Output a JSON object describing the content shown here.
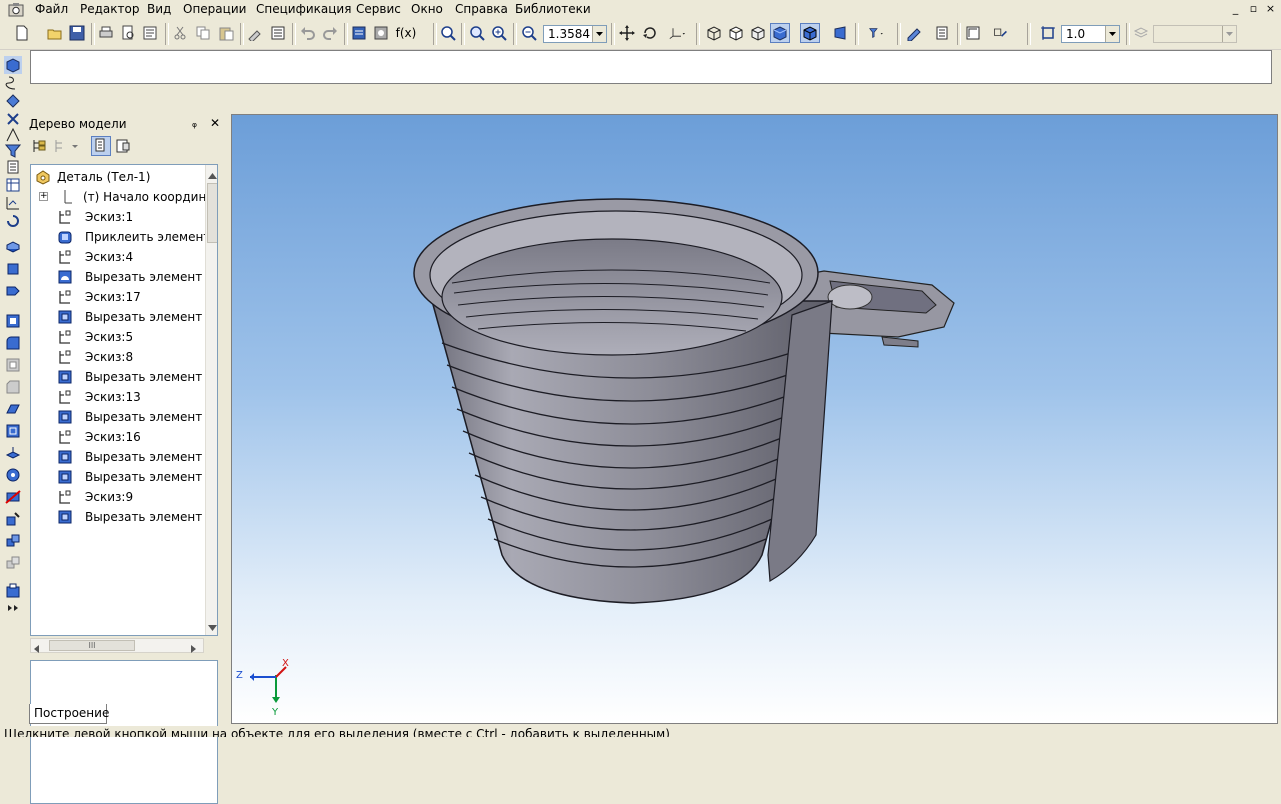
{
  "menu": {
    "items": [
      "Файл",
      "Редактор",
      "Вид",
      "Операции",
      "Спецификация",
      "Сервис",
      "Окно",
      "Справка",
      "Библиотеки"
    ],
    "window_controls": [
      "_",
      "▫",
      "×"
    ]
  },
  "toolbar": {
    "zoom_value": "1.3584",
    "step_value": "1.0",
    "fx_label": "f(x)"
  },
  "tree": {
    "title": "Дерево модели",
    "pin_glyph": "ᵩ",
    "close_glyph": "✕",
    "items": [
      {
        "label": "Деталь (Тел-1)",
        "icon": "part-icon"
      },
      {
        "label": "(т) Начало координат",
        "icon": "origin-icon"
      },
      {
        "label": "Эскиз:1",
        "icon": "sketch-icon"
      },
      {
        "label": "Приклеить элемент в",
        "icon": "extrude-icon"
      },
      {
        "label": "Эскиз:4",
        "icon": "sketch-icon"
      },
      {
        "label": "Вырезать элемент вр",
        "icon": "cut-revolve-icon"
      },
      {
        "label": "Эскиз:17",
        "icon": "sketch-icon"
      },
      {
        "label": "Вырезать элемент вы",
        "icon": "cut-extrude-icon"
      },
      {
        "label": "Эскиз:5",
        "icon": "sketch-icon"
      },
      {
        "label": "Эскиз:8",
        "icon": "sketch-icon"
      },
      {
        "label": "Вырезать элемент вы",
        "icon": "cut-extrude-icon"
      },
      {
        "label": "Эскиз:13",
        "icon": "sketch-icon"
      },
      {
        "label": "Вырезать элемент вы",
        "icon": "cut-extrude-icon"
      },
      {
        "label": "Эскиз:16",
        "icon": "sketch-icon"
      },
      {
        "label": "Вырезать элемент вы",
        "icon": "cut-extrude-icon"
      },
      {
        "label": "Вырезать элемент вы",
        "icon": "cut-extrude-icon"
      },
      {
        "label": "Эскиз:9",
        "icon": "sketch-icon"
      },
      {
        "label": "Вырезать элемент вы",
        "icon": "cut-extrude-icon"
      }
    ],
    "hscroll_grip": "III",
    "tab_label": "Построение"
  },
  "viewport": {
    "axis_z": "Z",
    "axis_x": "X",
    "axis_y": "Y"
  },
  "status": {
    "text": "Щелкните левой кнопкой мыши на объекте для его выделения (вместе с Ctrl - добавить к выделенным)"
  }
}
